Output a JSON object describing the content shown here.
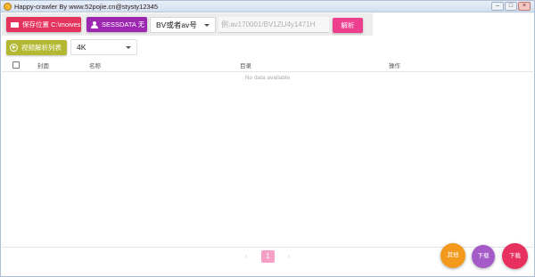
{
  "window": {
    "title": "Happy-crawler By www.52pojie.cn@stysty12345"
  },
  "toolbar": {
    "save_location_label": "保存位置 C:\\moives",
    "sessdata_label": "SESSDATA 无",
    "mode_select_value": "BV或者av号",
    "url_placeholder": "例:av170001/BV1ZU4y1471H",
    "parse_label": "解析"
  },
  "list_controls": {
    "parse_list_label": "视频解析列表",
    "quality_value": "4K"
  },
  "table": {
    "columns": [
      "封面",
      "名称",
      "目录",
      "操作"
    ],
    "empty_text": "No data available"
  },
  "pagination": {
    "prev": "‹",
    "current": "1",
    "next": "›"
  },
  "fabs": {
    "other": "其他",
    "mid": "下载",
    "download": "下载"
  },
  "colors": {
    "save_button": "#e4345e",
    "sessdata_button": "#9c27b0",
    "parse_button": "#ee3f8f",
    "list_button": "#b3b832",
    "fab_other": "#f39a1e",
    "fab_mid": "#a45ac7",
    "fab_download": "#e8305f"
  },
  "icons": [
    "app-icon",
    "folder-icon",
    "user-icon",
    "play-circle-icon",
    "chevron-down-icon"
  ]
}
